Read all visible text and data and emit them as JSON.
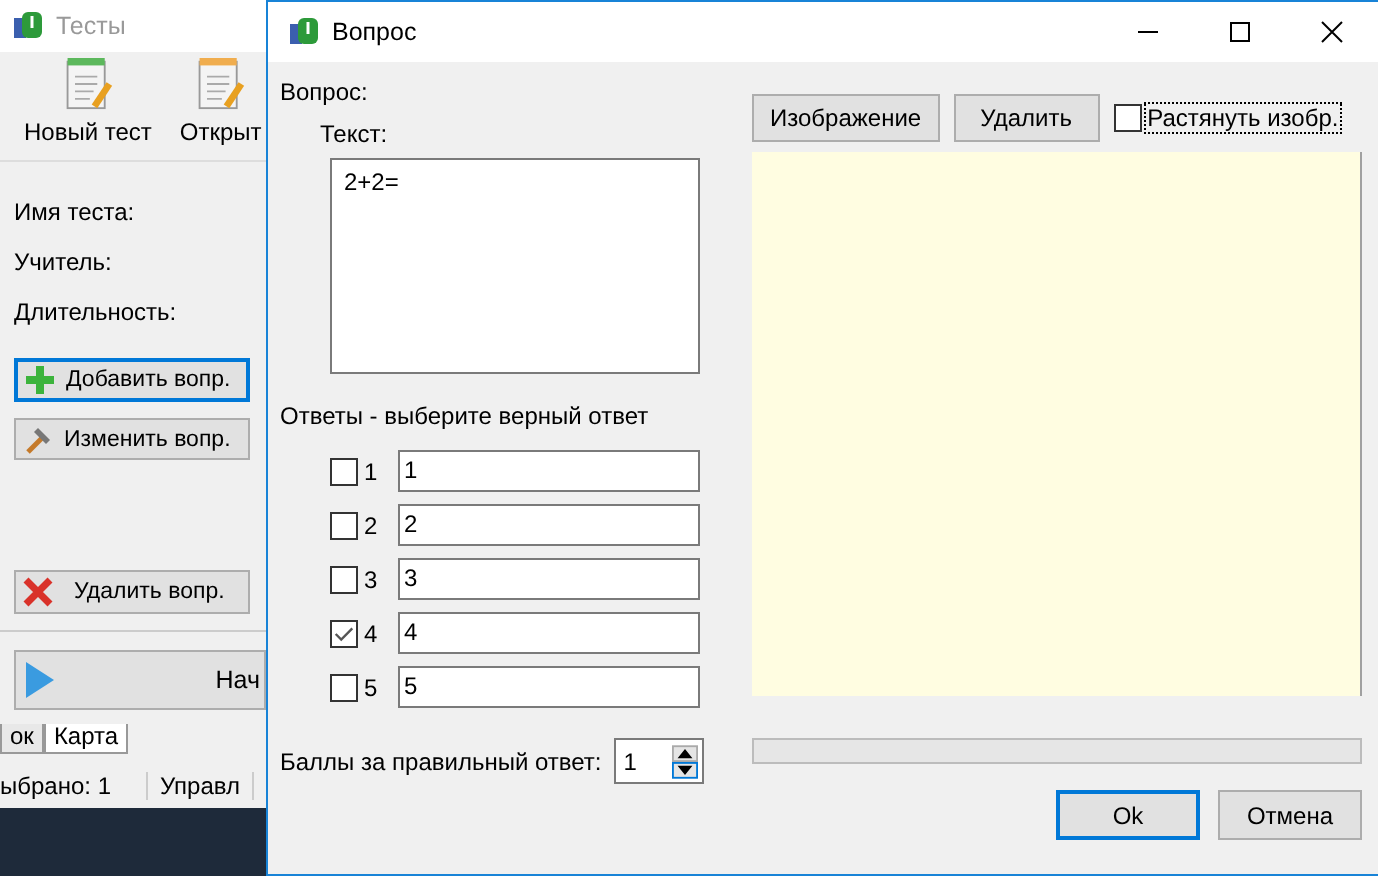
{
  "background_window": {
    "title": "Тесты",
    "toolbar": [
      {
        "label": "Новый тест"
      },
      {
        "label": "Открыт"
      }
    ],
    "fields": [
      "Имя теста:",
      "Учитель:",
      "Длительность:"
    ],
    "buttons": [
      {
        "label": "Добавить вопр.",
        "kind": "add",
        "focused": true
      },
      {
        "label": "Изменить вопр.",
        "kind": "edit",
        "focused": false
      },
      {
        "label": "Удалить вопр.",
        "kind": "delete",
        "focused": false
      }
    ],
    "start_button": "Нач",
    "tabs": [
      {
        "label": "ок",
        "selected": false
      },
      {
        "label": "Карта",
        "selected": true
      }
    ],
    "status_bar": [
      "ыбрано: 1",
      "Управл"
    ]
  },
  "dialog": {
    "title": "Вопрос",
    "question_label": "Вопрос:",
    "text_label": "Текст:",
    "text_value": "2+2=",
    "answers_label": "Ответы - выберите верный ответ",
    "answers": [
      {
        "number": "1",
        "value": "1",
        "checked": false
      },
      {
        "number": "2",
        "value": "2",
        "checked": false
      },
      {
        "number": "3",
        "value": "3",
        "checked": false
      },
      {
        "number": "4",
        "value": "4",
        "checked": true
      },
      {
        "number": "5",
        "value": "5",
        "checked": false
      }
    ],
    "points_label": "Баллы за правильный ответ:",
    "points_value": "1",
    "image_buttons": [
      "Изображение",
      "Удалить"
    ],
    "stretch": {
      "label": "Растянуть изобр.",
      "checked": false
    },
    "progress": {
      "level": 0
    },
    "buttons": [
      {
        "label": "Ok",
        "focused": true
      },
      {
        "label": "Отмена",
        "focused": false
      }
    ]
  }
}
